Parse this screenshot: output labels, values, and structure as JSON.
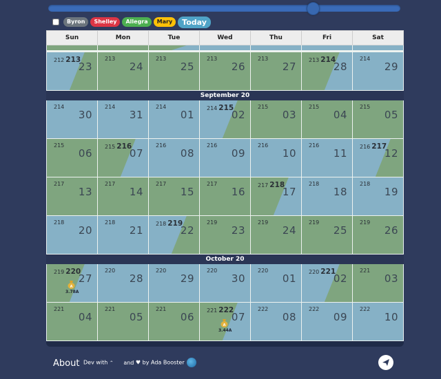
{
  "slider": {
    "value_fraction": 0.75
  },
  "legend": {
    "checkbox_checked": false,
    "chips": [
      {
        "label": "Byron",
        "color": "#6c757d"
      },
      {
        "label": "Shelley",
        "color": "#dc3545"
      },
      {
        "label": "Allegra",
        "color": "#4caf50"
      },
      {
        "label": "Mary",
        "color": "#ffc107",
        "text_color": "#222"
      }
    ],
    "today_label": "Today",
    "today_color": "#4fa3c7"
  },
  "colors": {
    "green": "#7fa57f",
    "blue": "#86b1c6"
  },
  "weekdays": [
    "Sun",
    "Mon",
    "Tue",
    "Wed",
    "Thu",
    "Fri",
    "Sat"
  ],
  "partial_row": [
    "green",
    "green",
    "green-blue",
    "blue",
    "blue",
    "blue",
    "blue"
  ],
  "blocks": [
    {
      "month_label": "",
      "weeks": [
        [
          {
            "n": "212",
            "b": "213",
            "day": "23",
            "fill": "blue-green"
          },
          {
            "n": "213",
            "day": "24",
            "fill": "green"
          },
          {
            "n": "213",
            "day": "25",
            "fill": "green"
          },
          {
            "n": "213",
            "day": "26",
            "fill": "green"
          },
          {
            "n": "213",
            "day": "27",
            "fill": "green"
          },
          {
            "n": "213",
            "b": "214",
            "day": "28",
            "fill": "green-blue"
          },
          {
            "n": "214",
            "day": "29",
            "fill": "blue"
          }
        ]
      ]
    },
    {
      "month_label": "September 20",
      "weeks": [
        [
          {
            "n": "214",
            "day": "30",
            "fill": "blue"
          },
          {
            "n": "214",
            "day": "31",
            "fill": "blue"
          },
          {
            "n": "214",
            "day": "01",
            "fill": "blue"
          },
          {
            "n": "214",
            "b": "215",
            "day": "02",
            "fill": "blue-green"
          },
          {
            "n": "215",
            "day": "03",
            "fill": "green"
          },
          {
            "n": "215",
            "day": "04",
            "fill": "green"
          },
          {
            "n": "215",
            "day": "05",
            "fill": "green"
          }
        ],
        [
          {
            "n": "215",
            "day": "06",
            "fill": "green"
          },
          {
            "n": "215",
            "b": "216",
            "day": "07",
            "fill": "green-blue"
          },
          {
            "n": "216",
            "day": "08",
            "fill": "blue"
          },
          {
            "n": "216",
            "day": "09",
            "fill": "blue"
          },
          {
            "n": "216",
            "day": "10",
            "fill": "blue"
          },
          {
            "n": "216",
            "day": "11",
            "fill": "blue"
          },
          {
            "n": "216",
            "b": "217",
            "day": "12",
            "fill": "blue-green"
          }
        ],
        [
          {
            "n": "217",
            "day": "13",
            "fill": "green"
          },
          {
            "n": "217",
            "day": "14",
            "fill": "green"
          },
          {
            "n": "217",
            "day": "15",
            "fill": "green"
          },
          {
            "n": "217",
            "day": "16",
            "fill": "green"
          },
          {
            "n": "217",
            "b": "218",
            "day": "17",
            "fill": "green-blue"
          },
          {
            "n": "218",
            "day": "18",
            "fill": "blue"
          },
          {
            "n": "218",
            "day": "19",
            "fill": "blue"
          }
        ],
        [
          {
            "n": "218",
            "day": "20",
            "fill": "blue"
          },
          {
            "n": "218",
            "day": "21",
            "fill": "blue"
          },
          {
            "n": "218",
            "b": "219",
            "day": "22",
            "fill": "blue-green"
          },
          {
            "n": "219",
            "day": "23",
            "fill": "green"
          },
          {
            "n": "219",
            "day": "24",
            "fill": "green"
          },
          {
            "n": "219",
            "day": "25",
            "fill": "green"
          },
          {
            "n": "219",
            "day": "26",
            "fill": "green"
          }
        ]
      ]
    },
    {
      "month_label": "October 20",
      "weeks": [
        [
          {
            "n": "219",
            "b": "220",
            "day": "27",
            "fill": "green-blue",
            "bag": "3.78A"
          },
          {
            "n": "220",
            "day": "28",
            "fill": "blue"
          },
          {
            "n": "220",
            "day": "29",
            "fill": "blue"
          },
          {
            "n": "220",
            "day": "30",
            "fill": "blue"
          },
          {
            "n": "220",
            "day": "01",
            "fill": "blue"
          },
          {
            "n": "220",
            "b": "221",
            "day": "02",
            "fill": "blue-green"
          },
          {
            "n": "221",
            "day": "03",
            "fill": "green"
          }
        ],
        [
          {
            "n": "221",
            "day": "04",
            "fill": "green"
          },
          {
            "n": "221",
            "day": "05",
            "fill": "green"
          },
          {
            "n": "221",
            "day": "06",
            "fill": "green"
          },
          {
            "n": "221",
            "b": "222",
            "day": "07",
            "fill": "green-blue",
            "bag": "3.44A"
          },
          {
            "n": "222",
            "day": "08",
            "fill": "blue"
          },
          {
            "n": "222",
            "day": "09",
            "fill": "blue"
          },
          {
            "n": "222",
            "day": "10",
            "fill": "blue"
          }
        ]
      ]
    }
  ],
  "footer": {
    "about_label": "About",
    "dev_with": "Dev with",
    "and_by": "and",
    "by_label": "by Ada Booster"
  }
}
